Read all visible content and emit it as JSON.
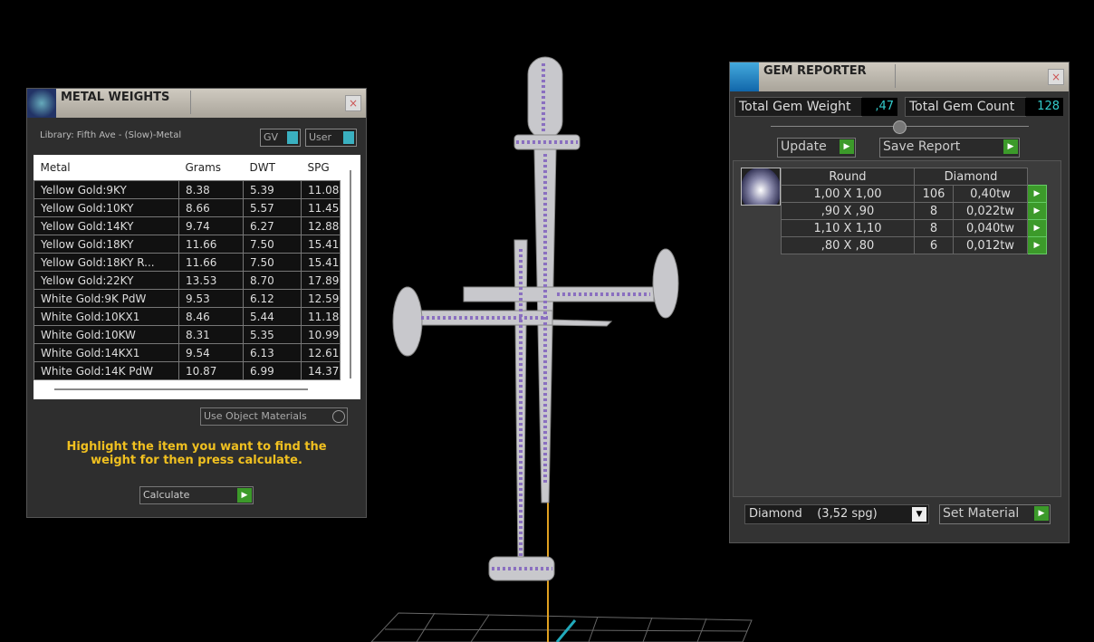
{
  "metal_weights": {
    "title": "METAL WEIGHTS",
    "close": "×",
    "library": "Library: Fifth Ave - (Slow)-Metal",
    "toggle_gv": "GV",
    "toggle_user": "User",
    "columns": [
      "Metal",
      "Grams",
      "DWT",
      "SPG"
    ],
    "rows": [
      [
        "Yellow Gold:9KY",
        "8.38",
        "5.39",
        "11.08"
      ],
      [
        "Yellow Gold:10KY",
        "8.66",
        "5.57",
        "11.45"
      ],
      [
        "Yellow Gold:14KY",
        "9.74",
        "6.27",
        "12.88"
      ],
      [
        "Yellow Gold:18KY",
        "11.66",
        "7.50",
        "15.41"
      ],
      [
        "Yellow Gold:18KY R...",
        "11.66",
        "7.50",
        "15.41"
      ],
      [
        "Yellow Gold:22KY",
        "13.53",
        "8.70",
        "17.89"
      ],
      [
        "White Gold:9K PdW",
        "9.53",
        "6.12",
        "12.59"
      ],
      [
        "White Gold:10KX1",
        "8.46",
        "5.44",
        "11.18"
      ],
      [
        "White Gold:10KW",
        "8.31",
        "5.35",
        "10.99"
      ],
      [
        "White Gold:14KX1",
        "9.54",
        "6.13",
        "12.61"
      ],
      [
        "White Gold:14K PdW",
        "10.87",
        "6.99",
        "14.37"
      ]
    ],
    "use_object_materials": "Use Object Materials",
    "hint": "Highlight the item you want to find the weight for then press calculate.",
    "calculate": "Calculate"
  },
  "gem_reporter": {
    "title": "GEM REPORTER",
    "close": "×",
    "total_weight_label": "Total Gem Weight",
    "total_weight": ",47",
    "total_count_label": "Total Gem Count",
    "total_count": "128",
    "update": "Update",
    "save_report": "Save Report",
    "header": [
      "Round",
      "Diamond"
    ],
    "rows": [
      [
        "1,00 X 1,00",
        "106",
        "0,40tw"
      ],
      [
        ",90 X ,90",
        "8",
        "0,022tw"
      ],
      [
        "1,10 X 1,10",
        "8",
        "0,040tw"
      ],
      [
        ",80 X ,80",
        "6",
        "0,012tw"
      ]
    ],
    "material_select": "Diamond    (3,52 spg)",
    "set_material": "Set Material"
  }
}
